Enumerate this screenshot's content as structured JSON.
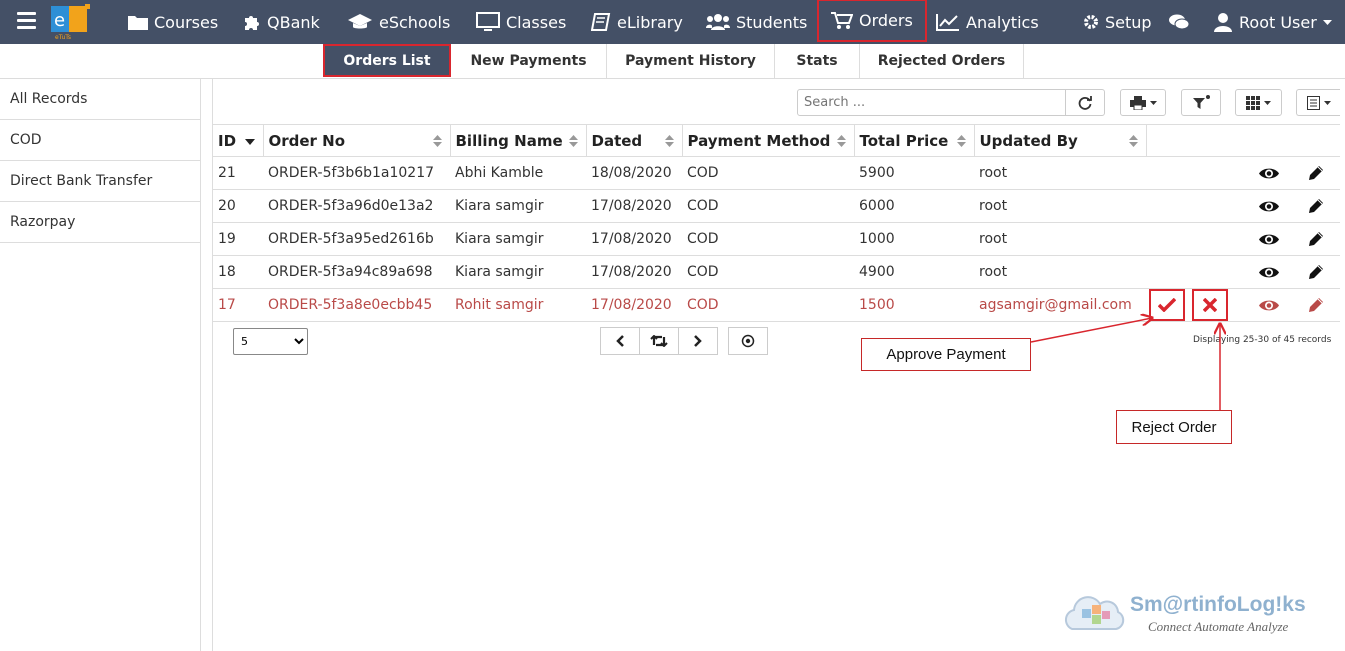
{
  "nav": {
    "courses": "Courses",
    "qbank": "QBank",
    "eschools": "eSchools",
    "classes": "Classes",
    "elibrary": "eLibrary",
    "students": "Students",
    "orders": "Orders",
    "analytics": "Analytics",
    "setup": "Setup",
    "user": "Root User"
  },
  "subtabs": [
    "Orders List",
    "New Payments",
    "Payment History",
    "Stats",
    "Rejected Orders"
  ],
  "sidebar": [
    "All Records",
    "COD",
    "Direct Bank Transfer",
    "Razorpay"
  ],
  "search": {
    "placeholder": "Search ..."
  },
  "table": {
    "headers": [
      "ID",
      "Order No",
      "Billing Name",
      "Dated",
      "Payment Method",
      "Total Price",
      "Updated By"
    ],
    "rows": [
      [
        "21",
        "ORDER-5f3b6b1a10217",
        "Abhi Kamble",
        "18/08/2020",
        "COD",
        "5900",
        "root"
      ],
      [
        "20",
        "ORDER-5f3a96d0e13a2",
        "Kiara samgir",
        "17/08/2020",
        "COD",
        "6000",
        "root"
      ],
      [
        "19",
        "ORDER-5f3a95ed2616b",
        "Kiara samgir",
        "17/08/2020",
        "COD",
        "1000",
        "root"
      ],
      [
        "18",
        "ORDER-5f3a94c89a698",
        "Kiara samgir",
        "17/08/2020",
        "COD",
        "4900",
        "root"
      ],
      [
        "17",
        "ORDER-5f3a8e0ecbb45",
        "Rohit samgir",
        "17/08/2020",
        "COD",
        "1500",
        "agsamgir@gmail.com"
      ]
    ]
  },
  "pagination": {
    "page_size": "5",
    "records_text": "Displaying 25-30 of 45 records"
  },
  "callouts": {
    "approve": "Approve Payment",
    "reject": "Reject Order"
  },
  "watermark": {
    "title": "Sm@rtinfoLog!ks",
    "subtitle": "Connect Automate Analyze"
  },
  "colors": {
    "navbar": "#445066",
    "annotation": "#d9262e",
    "warning_row": "#b94a48"
  }
}
